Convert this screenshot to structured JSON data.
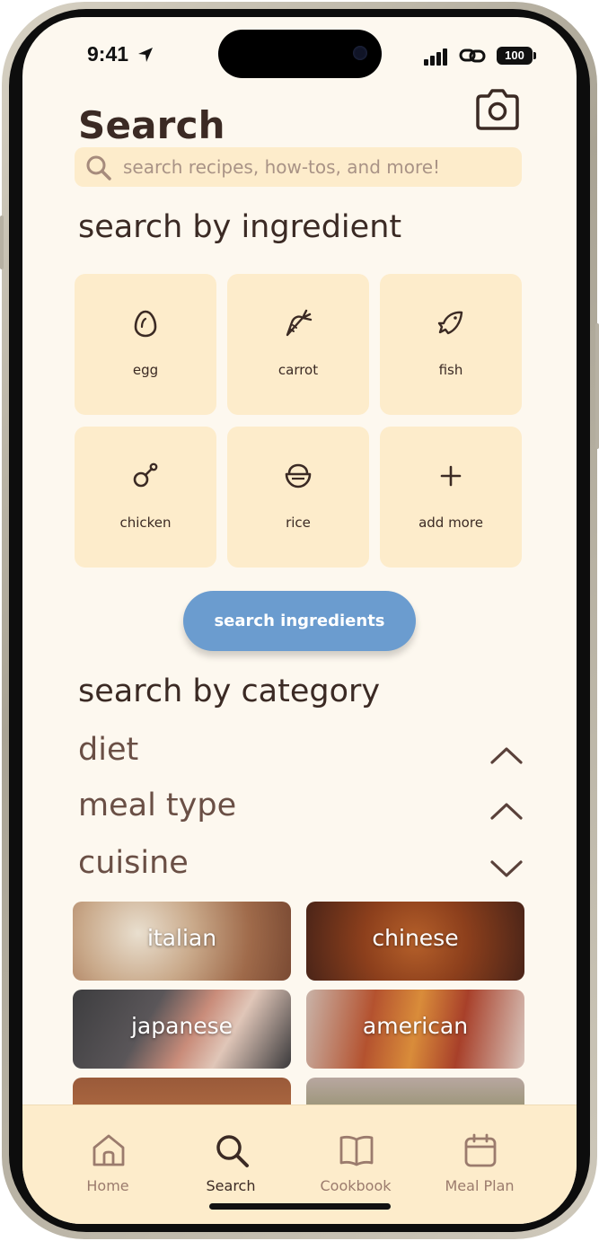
{
  "status_bar": {
    "time": "9:41",
    "battery": "100"
  },
  "header": {
    "title": "Search"
  },
  "search": {
    "placeholder": "search recipes, how-tos, and more!"
  },
  "ingredient_section": {
    "title": "search by ingredient",
    "items": [
      {
        "label": "egg",
        "icon": "egg-icon"
      },
      {
        "label": "carrot",
        "icon": "carrot-icon"
      },
      {
        "label": "fish",
        "icon": "fish-icon"
      },
      {
        "label": "chicken",
        "icon": "chicken-leg-icon"
      },
      {
        "label": "rice",
        "icon": "rice-bowl-icon"
      },
      {
        "label": "add more",
        "icon": "plus-icon"
      }
    ],
    "button_label": "search ingredients"
  },
  "category_section": {
    "title": "search by category",
    "groups": [
      {
        "label": "diet",
        "state": "collapsed"
      },
      {
        "label": "meal type",
        "state": "collapsed"
      },
      {
        "label": "cuisine",
        "state": "expanded"
      }
    ],
    "cuisines": [
      {
        "label": "italian"
      },
      {
        "label": "chinese"
      },
      {
        "label": "japanese"
      },
      {
        "label": "american"
      }
    ]
  },
  "tab_bar": {
    "tabs": [
      {
        "label": "Home",
        "icon": "home-icon"
      },
      {
        "label": "Search",
        "icon": "search-icon",
        "active": true
      },
      {
        "label": "Cookbook",
        "icon": "book-icon"
      },
      {
        "label": "Meal Plan",
        "icon": "calendar-icon"
      }
    ]
  },
  "colors": {
    "background": "#fdf8ef",
    "tile": "#fdeccb",
    "primary_button": "#6b9ccf",
    "text_dark": "#3b2a24",
    "text_muted": "#6a4f45"
  }
}
